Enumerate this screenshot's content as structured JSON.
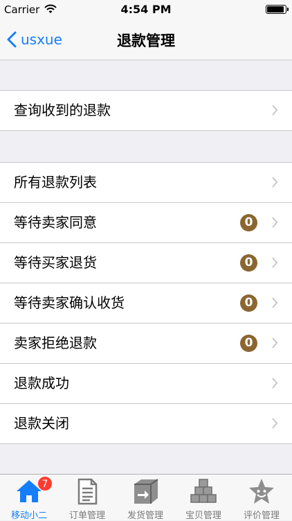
{
  "status_bar": {
    "carrier": "Carrier",
    "time": "4:54 PM"
  },
  "nav": {
    "back_label": "usxue",
    "title": "退款管理"
  },
  "group1": [
    {
      "label": "查询收到的退款"
    }
  ],
  "group2": [
    {
      "label": "所有退款列表",
      "badge": ""
    },
    {
      "label": "等待卖家同意",
      "badge": "0"
    },
    {
      "label": "等待买家退货",
      "badge": "0"
    },
    {
      "label": "等待卖家确认收货",
      "badge": "0"
    },
    {
      "label": "卖家拒绝退款",
      "badge": "0"
    },
    {
      "label": "退款成功",
      "badge": ""
    },
    {
      "label": "退款关闭",
      "badge": ""
    }
  ],
  "tabs": [
    {
      "label": "移动小二",
      "badge": "7",
      "icon": "home-icon"
    },
    {
      "label": "订单管理",
      "badge": "",
      "icon": "document-icon"
    },
    {
      "label": "发货管理",
      "badge": "",
      "icon": "shipping-box-icon"
    },
    {
      "label": "宝贝管理",
      "badge": "",
      "icon": "stacked-boxes-icon"
    },
    {
      "label": "评价管理",
      "badge": "",
      "icon": "star-face-icon"
    }
  ],
  "colors": {
    "accent": "#147efb",
    "badge": "#8b6630",
    "tab_badge": "#ff3b30"
  }
}
